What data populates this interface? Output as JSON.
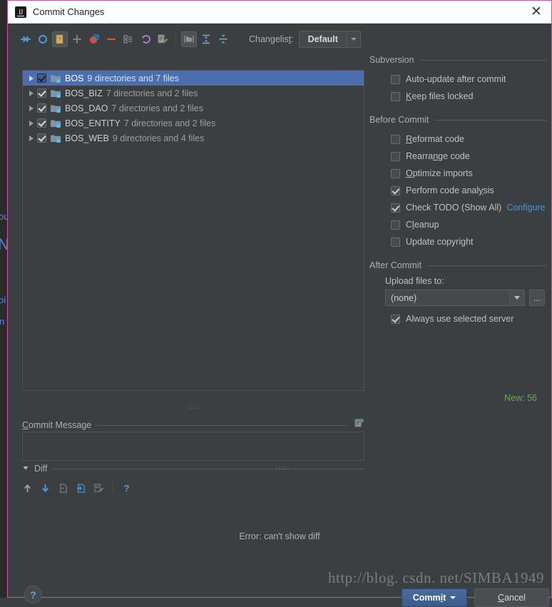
{
  "window": {
    "title": "Commit Changes",
    "app_icon": "intellij-idea-icon",
    "close_label": "✕"
  },
  "toolbar": {
    "items": [
      {
        "name": "show-diff-icon",
        "tip": "Show Diff"
      },
      {
        "name": "refresh-icon",
        "tip": "Refresh Changes"
      },
      {
        "name": "new-changelist-icon",
        "tip": "New Changelist"
      },
      {
        "name": "add-icon",
        "tip": "Add"
      },
      {
        "name": "move-to-another-changelist-icon",
        "tip": "Move to Another Changelist"
      },
      {
        "name": "delete-icon",
        "tip": "Delete"
      },
      {
        "name": "set-active-changelist-icon",
        "tip": "Set Active Changelist"
      },
      {
        "name": "revert-icon",
        "tip": "Revert"
      },
      {
        "name": "edit-source-icon",
        "tip": "Edit Source"
      },
      {
        "name": "group-by-directory-icon",
        "tip": "Group by Directory",
        "pressed": true
      },
      {
        "name": "expand-all-icon",
        "tip": "Expand All"
      },
      {
        "name": "collapse-all-icon",
        "tip": "Collapse All"
      }
    ],
    "changelist_label": "Changelist:",
    "changelist_label_mnemonic": "t",
    "changelist_value": "Default"
  },
  "tree": {
    "rows": [
      {
        "name": "BOS",
        "desc": "9 directories and 7 files",
        "checked": true,
        "selected": true
      },
      {
        "name": "BOS_BIZ",
        "desc": "7 directories and 2 files",
        "checked": true,
        "selected": false
      },
      {
        "name": "BOS_DAO",
        "desc": "7 directories and 2 files",
        "checked": true,
        "selected": false
      },
      {
        "name": "BOS_ENTITY",
        "desc": "7 directories and 2 files",
        "checked": true,
        "selected": false
      },
      {
        "name": "BOS_WEB",
        "desc": "9 directories and 4 files",
        "checked": true,
        "selected": false
      }
    ],
    "new_count": "New: 56",
    "new_count_color": "#6aa84f"
  },
  "commit_message": {
    "label_prefix": "C",
    "label_rest": "ommit Message",
    "value": "",
    "placeholder": "",
    "history_icon": "message-history-icon"
  },
  "diff": {
    "label": "Diff",
    "collapse_icon": "triangle-down-icon",
    "toolbar": [
      {
        "name": "previous-difference-icon"
      },
      {
        "name": "next-difference-icon"
      },
      {
        "name": "revert-change-icon"
      },
      {
        "name": "apply-change-icon"
      },
      {
        "name": "edit-source-icon"
      },
      {
        "name": "help-icon"
      }
    ],
    "error_text": "Error: can't show diff"
  },
  "options": {
    "groups": [
      {
        "title": "Subversion",
        "rows": [
          {
            "mnem": "",
            "pre": "Auto-update after commit",
            "post": "",
            "checked": false,
            "link": ""
          },
          {
            "mnem": "K",
            "pre": "",
            "post": "eep files locked",
            "checked": false,
            "link": ""
          }
        ]
      },
      {
        "title": "Before Commit",
        "rows": [
          {
            "mnem": "R",
            "pre": "",
            "post": "eformat code",
            "checked": false,
            "link": ""
          },
          {
            "mnem": "",
            "pre": "Rearrange code",
            "post": "",
            "checked": false,
            "link": ""
          },
          {
            "mnem": "O",
            "pre": "",
            "post": "ptimize imports",
            "checked": false,
            "link": ""
          },
          {
            "mnem": "",
            "pre": "Perform code analysis",
            "post": "",
            "checked": true,
            "link": ""
          },
          {
            "mnem": "",
            "pre": "Check TODO (Show All)",
            "post": "",
            "checked": true,
            "link": "Configure"
          },
          {
            "mnem": "C",
            "pre": "",
            "post": "leanup",
            "checked": false,
            "link": ""
          },
          {
            "mnem": "",
            "pre": "Update copyright",
            "post": "",
            "checked": false,
            "link": ""
          }
        ]
      }
    ],
    "after_commit": {
      "title": "After Commit",
      "upload_label": "Upload files to:",
      "upload_value": "(none)",
      "browse_label": "...",
      "always_use_label": "Always use selected server",
      "always_use_checked": true
    }
  },
  "footer": {
    "help_label": "?",
    "commit_pre": "Comm",
    "commit_mnem": "i",
    "commit_post": "t",
    "cancel_pre": "",
    "cancel_mnem": "C",
    "cancel_post": "ancel"
  },
  "watermark": {
    "text": "http://blog. csdn. net/SIMBA1949"
  },
  "backdrop": {
    "fragments": [
      "ou",
      "N",
      "oi",
      "n"
    ]
  },
  "colors": {
    "dialog_bg": "#3c3f41",
    "titlebar_bg": "#ffffff",
    "border": "#d14fa6",
    "selection": "#4b6eaf",
    "accent_link": "#4f91d2",
    "new_green": "#6aa84f",
    "text": "#bcc1c4"
  }
}
